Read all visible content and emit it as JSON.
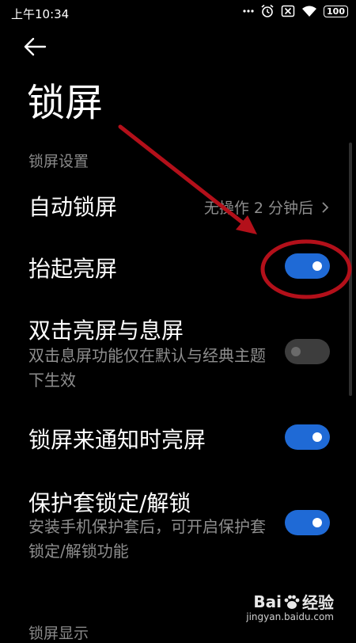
{
  "status_bar": {
    "time": "上午10:34",
    "battery": "100",
    "icons": [
      "more-dots-icon",
      "alarm-icon",
      "sim-disabled-icon",
      "wifi-icon",
      "battery-icon"
    ]
  },
  "header": {
    "back_icon": "back-arrow-icon",
    "title": "锁屏"
  },
  "section": {
    "label": "锁屏设置"
  },
  "settings": [
    {
      "title": "自动锁屏",
      "value": "无操作 2 分钟后",
      "control": "chevron"
    },
    {
      "title": "抬起亮屏",
      "toggle": "on"
    },
    {
      "title": "双击亮屏与息屏",
      "desc": "双击息屏功能仅在默认与经典主题下生效",
      "toggle": "off"
    },
    {
      "title": "锁屏来通知时亮屏",
      "toggle": "on"
    },
    {
      "title": "保护套锁定/解锁",
      "desc": "安装手机保护套后，可开启保护套锁定/解锁功能",
      "toggle": "on"
    }
  ],
  "next_section": {
    "label": "锁屏显示"
  },
  "watermark": {
    "brand_left": "Bai",
    "brand_right": "经验",
    "url": "jingyan.baidu.com"
  },
  "colors": {
    "accent": "#1f6ad6",
    "annotation": "#b3101a",
    "background": "#000000"
  }
}
